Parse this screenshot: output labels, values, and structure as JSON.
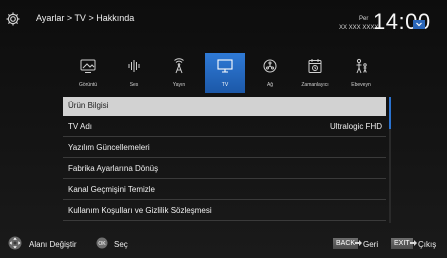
{
  "header": {
    "breadcrumb": "Ayarlar > TV > Hakkında",
    "clock": {
      "day": "Per",
      "date": "XX XXX XXXX",
      "time": "14:00"
    }
  },
  "categories": [
    {
      "label": "Görüntü",
      "icon": "picture-icon",
      "active": false
    },
    {
      "label": "Ses",
      "icon": "sound-icon",
      "active": false
    },
    {
      "label": "Yayın",
      "icon": "broadcast-icon",
      "active": false
    },
    {
      "label": "TV",
      "icon": "tv-icon",
      "active": true
    },
    {
      "label": "Ağ",
      "icon": "network-icon",
      "active": false
    },
    {
      "label": "Zamanlayıcı",
      "icon": "timer-icon",
      "active": false
    },
    {
      "label": "Ebeveyn",
      "icon": "parental-icon",
      "active": false
    }
  ],
  "menu": {
    "items": [
      {
        "label": "Ürün Bilgisi",
        "value": "",
        "selected": true
      },
      {
        "label": "TV Adı",
        "value": "Ultralogic FHD",
        "selected": false
      },
      {
        "label": "Yazılım Güncellemeleri",
        "value": "",
        "selected": false
      },
      {
        "label": "Fabrika Ayarlarına Dönüş",
        "value": "",
        "selected": false
      },
      {
        "label": "Kanal Geçmişini Temizle",
        "value": "",
        "selected": false
      },
      {
        "label": "Kullanım Koşulları ve Gizlilik Sözleşmesi",
        "value": "",
        "selected": false
      }
    ]
  },
  "footer": {
    "navigate_label": "Alanı Değiştir",
    "ok_key": "OK",
    "select_label": "Seç",
    "back_key": "BACK",
    "back_label": "Geri",
    "exit_key": "EXIT",
    "exit_label": "Çıkış"
  },
  "colors": {
    "accent": "#2b73d0",
    "selected_row": "#d2d2d2",
    "background": "#121212"
  }
}
